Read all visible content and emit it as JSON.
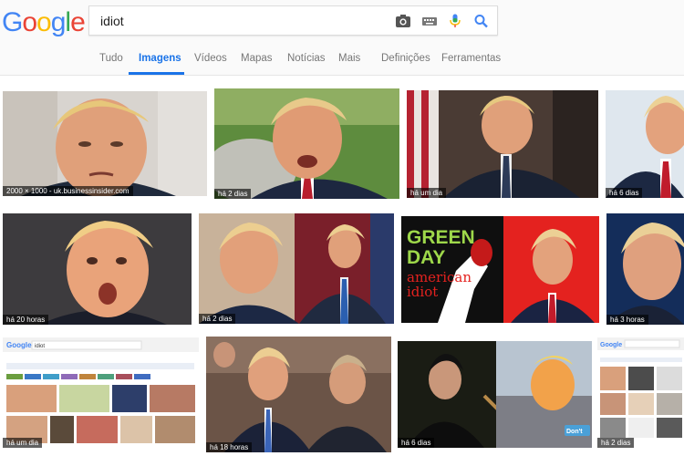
{
  "logo": {
    "letters": [
      "G",
      "o",
      "o",
      "g",
      "l",
      "e"
    ],
    "colors": [
      "#4285f4",
      "#ea4335",
      "#fbbc05",
      "#4285f4",
      "#34a853",
      "#ea4335"
    ]
  },
  "search": {
    "value": "idiot"
  },
  "icons": {
    "camera": "camera-icon",
    "keyboard": "keyboard-icon",
    "mic": "microphone-icon",
    "search": "search-icon"
  },
  "tabs": [
    "Tudo",
    "Imagens",
    "Vídeos",
    "Mapas",
    "Notícias",
    "Mais",
    "Definições",
    "Ferramentas"
  ],
  "active_tab": "Imagens",
  "results": [
    {
      "caption": "2000 × 1000 - uk.businessinsider.com"
    },
    {
      "caption": "há 2 dias"
    },
    {
      "caption": "há um dia"
    },
    {
      "caption": "há 6 dias"
    },
    {
      "caption": "há 20 horas"
    },
    {
      "caption": "há 2 dias"
    },
    {
      "caption": "",
      "album": {
        "line1": "GREEN",
        "line2": "DAY",
        "line3": "american",
        "line4": "idiot"
      }
    },
    {
      "caption": "há 3 horas"
    },
    {
      "caption": "há um dia",
      "mini_search": "idiot"
    },
    {
      "caption": "há 18 horas"
    },
    {
      "caption": "há 6 dias",
      "sign": "Don't"
    },
    {
      "caption": "há 2 dias"
    }
  ]
}
